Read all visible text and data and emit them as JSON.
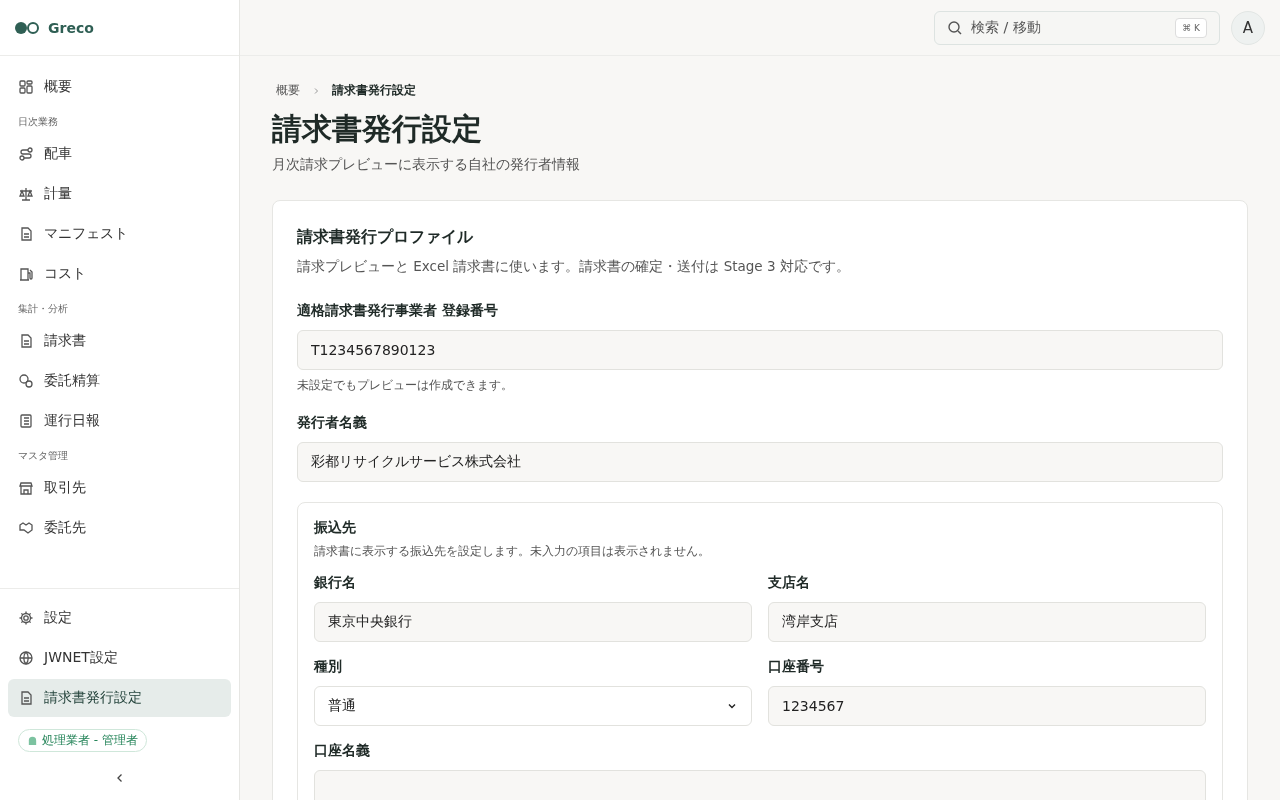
{
  "brand": {
    "name": "Greco"
  },
  "sidebar": {
    "nav": [
      {
        "kind": "item",
        "label": "概要",
        "selected": false
      },
      {
        "kind": "section",
        "label": "日次業務"
      },
      {
        "kind": "item",
        "label": "配車",
        "selected": false
      },
      {
        "kind": "item",
        "label": "計量",
        "selected": false
      },
      {
        "kind": "item",
        "label": "マニフェスト",
        "selected": false
      },
      {
        "kind": "item",
        "label": "コスト",
        "selected": false
      },
      {
        "kind": "section",
        "label": "集計・分析"
      },
      {
        "kind": "item",
        "label": "請求書",
        "selected": false
      },
      {
        "kind": "item",
        "label": "委託精算",
        "selected": false
      },
      {
        "kind": "item",
        "label": "運行日報",
        "selected": false
      },
      {
        "kind": "section",
        "label": "マスタ管理"
      },
      {
        "kind": "item",
        "label": "取引先",
        "selected": false
      },
      {
        "kind": "item",
        "label": "委託先",
        "selected": false
      }
    ],
    "bottom": [
      {
        "label": "設定",
        "selected": false
      },
      {
        "label": "JWNET設定",
        "selected": false
      },
      {
        "label": "請求書発行設定",
        "selected": true
      }
    ],
    "role_badge": "処理業者 - 管理者"
  },
  "header": {
    "search": {
      "placeholder": "検索 / 移動",
      "shortcut": "⌘ K"
    },
    "avatar": "A"
  },
  "breadcrumb": [
    "概要",
    "請求書発行設定"
  ],
  "page": {
    "title": "請求書発行設定",
    "subtitle": "月次請求プレビューに表示する自社の発行者情報"
  },
  "card": {
    "title": "請求書発行プロファイル",
    "description": "請求プレビューと Excel 請求書に使います。請求書の確定・送付は Stage 3 対応です。",
    "fields": [
      {
        "label": "適格請求書発行事業者 登録番号",
        "value": "T1234567890123",
        "help": "未設定でもプレビューは作成できます。"
      },
      {
        "label": "発行者名義",
        "value": "彩都リサイクルサービス株式会社"
      }
    ],
    "bank": {
      "title": "振込先",
      "description": "請求書に表示する振込先を設定します。未入力の項目は表示されません。",
      "fields": [
        {
          "kind": "text",
          "label": "銀行名",
          "value": "東京中央銀行"
        },
        {
          "kind": "text",
          "label": "支店名",
          "value": "湾岸支店"
        },
        {
          "kind": "select",
          "label": "種別",
          "value": "普通"
        },
        {
          "kind": "text",
          "label": "口座番号",
          "value": "1234567"
        },
        {
          "kind": "text",
          "label": "口座名義"
        }
      ]
    }
  }
}
